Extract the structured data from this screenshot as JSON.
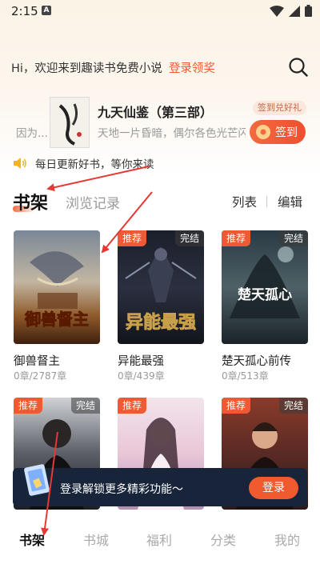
{
  "status_bar": {
    "time": "2:15",
    "notification_letter": "A"
  },
  "header": {
    "greeting": "Hi，欢迎来到趣读书免费小说",
    "login_link": "登录领奖"
  },
  "featured": {
    "title": "九天仙鉴（第三部）",
    "prefix": "因为...",
    "description": "天地一片昏暗，偶尔各色光芒闪过",
    "signin_tip": "签到兑好礼",
    "signin_label": "签到"
  },
  "notice": {
    "text": "每日更新好书，等你来读"
  },
  "tabs": {
    "shelf": "书架",
    "history": "浏览记录",
    "list": "列表",
    "edit": "编辑"
  },
  "books": [
    {
      "title": "御兽督主",
      "progress": "0章/2787章",
      "badge_rec": "",
      "badge_done": "",
      "cover_text": "御兽督主"
    },
    {
      "title": "异能最强",
      "progress": "0章/439章",
      "badge_rec": "推荐",
      "badge_done": "完结",
      "cover_text": "异能最强"
    },
    {
      "title": "楚天孤心前传",
      "progress": "0章/513章",
      "badge_rec": "推荐",
      "badge_done": "完结",
      "cover_text": "楚天孤心"
    },
    {
      "badge_rec": "推荐",
      "badge_done": "完结"
    },
    {
      "badge_rec": "推荐",
      "badge_done": ""
    },
    {
      "badge_rec": "推荐",
      "badge_done": "完结"
    }
  ],
  "login_banner": {
    "text": "登录解锁更多精彩功能～",
    "button": "登录"
  },
  "bottom_nav": {
    "items": [
      "书架",
      "书城",
      "福利",
      "分类",
      "我的"
    ],
    "active": "书架"
  },
  "colors": {
    "accent": "#f05a2e",
    "banner_bg": "#17243a",
    "annotation": "#e53935"
  }
}
